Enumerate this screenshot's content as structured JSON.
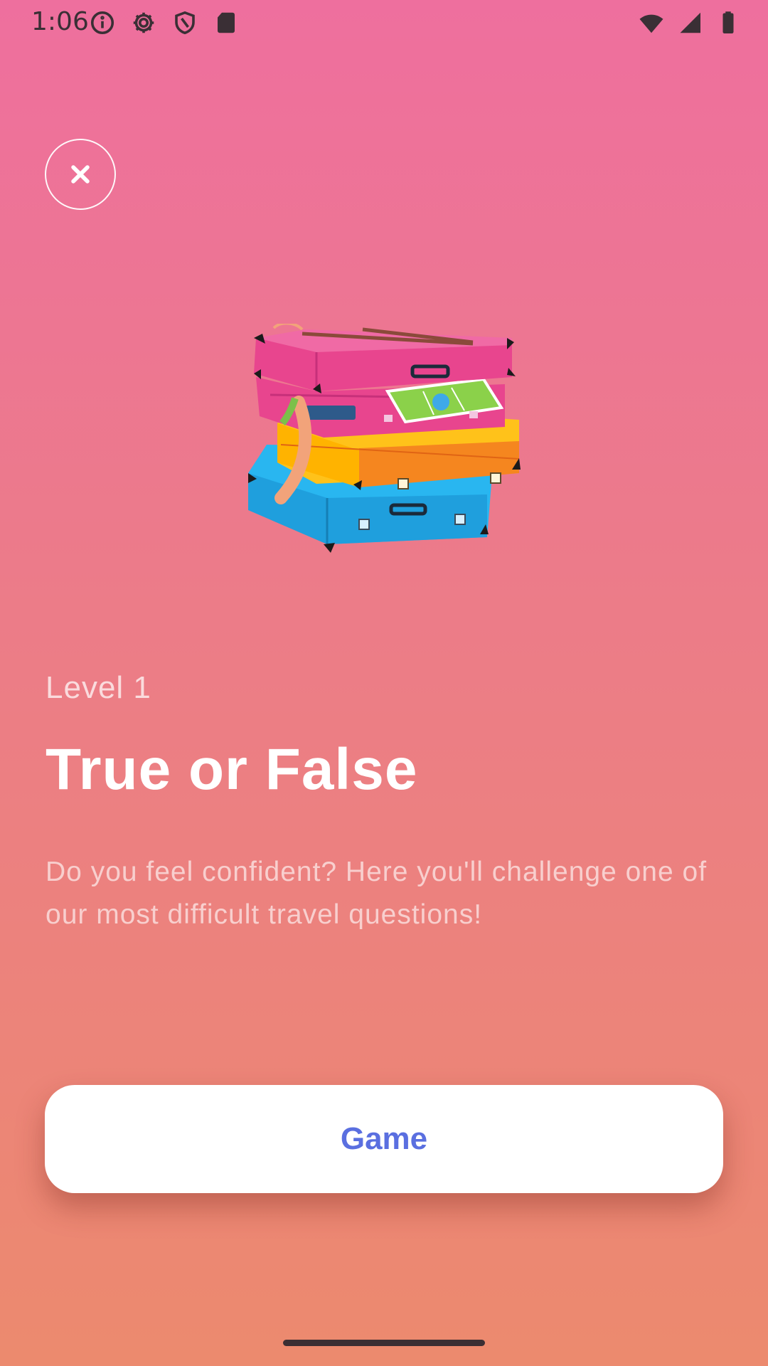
{
  "status_bar": {
    "time": "1:06",
    "left_icons": [
      "info-icon",
      "gear-icon",
      "shield-icon",
      "sd-card-icon"
    ],
    "right_icons": [
      "wifi-icon",
      "signal-icon",
      "battery-icon"
    ]
  },
  "close_button": {
    "icon": "close-icon"
  },
  "illustration": {
    "subject": "stacked suitcases"
  },
  "level": {
    "label": "Level 1"
  },
  "title": "True or False",
  "description": "Do you feel confident? Here you'll challenge one of our most difficult travel questions!",
  "game_button": {
    "label": "Game",
    "text_color": "#5a6fe0"
  },
  "colors": {
    "gradient_top": "#EE6F9E",
    "gradient_bottom": "#EC8A6E"
  }
}
